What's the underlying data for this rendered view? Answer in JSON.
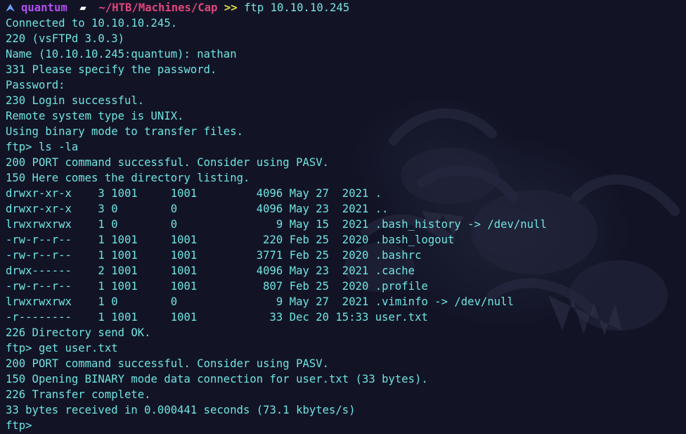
{
  "window": {
    "background_color": "#121426",
    "text_color": "#6fe3e0"
  },
  "prompt": {
    "os_icon": "arch-linux-icon",
    "os_glyph": "⮝",
    "user": "quantum",
    "folder_icon": "folder-icon",
    "folder_glyph": "▰",
    "path": "~/HTB/Machines/Cap",
    "separator": ">>",
    "command": "ftp 10.10.10.245",
    "colors": {
      "user": "#b14ef2",
      "path": "#e0457a",
      "separator": "#e5d94a"
    }
  },
  "output_lines": [
    "Connected to 10.10.10.245.",
    "220 (vsFTPd 3.0.3)",
    "Name (10.10.10.245:quantum): nathan",
    "331 Please specify the password.",
    "Password:",
    "230 Login successful.",
    "Remote system type is UNIX.",
    "Using binary mode to transfer files.",
    "ftp> ls -la",
    "200 PORT command successful. Consider using PASV.",
    "150 Here comes the directory listing.",
    "drwxr-xr-x    3 1001     1001         4096 May 27  2021 .",
    "drwxr-xr-x    3 0        0            4096 May 23  2021 ..",
    "lrwxrwxrwx    1 0        0               9 May 15  2021 .bash_history -> /dev/null",
    "-rw-r--r--    1 1001     1001          220 Feb 25  2020 .bash_logout",
    "-rw-r--r--    1 1001     1001         3771 Feb 25  2020 .bashrc",
    "drwx------    2 1001     1001         4096 May 23  2021 .cache",
    "-rw-r--r--    1 1001     1001          807 Feb 25  2020 .profile",
    "lrwxrwxrwx    1 0        0               9 May 27  2021 .viminfo -> /dev/null",
    "-r--------    1 1001     1001           33 Dec 20 15:33 user.txt",
    "226 Directory send OK.",
    "ftp> get user.txt",
    "200 PORT command successful. Consider using PASV.",
    "150 Opening BINARY mode data connection for user.txt (33 bytes).",
    "226 Transfer complete.",
    "33 bytes received in 0.000441 seconds (73.1 kbytes/s)",
    "ftp> "
  ]
}
